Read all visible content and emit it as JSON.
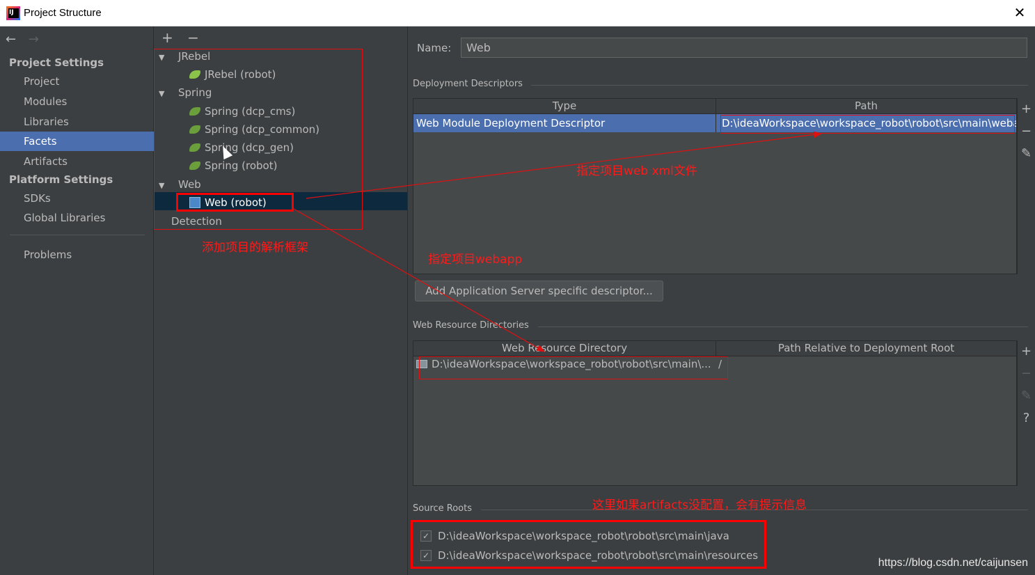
{
  "window": {
    "title": "Project Structure",
    "close_glyph": "✕"
  },
  "nav": {
    "back": "←",
    "forward": "→",
    "project_settings_header": "Project Settings",
    "platform_settings_header": "Platform Settings",
    "items": [
      "Project",
      "Modules",
      "Libraries",
      "Facets",
      "Artifacts"
    ],
    "platform_items": [
      "SDKs",
      "Global Libraries"
    ],
    "problems": "Problems",
    "selected": "Facets"
  },
  "tree": {
    "add": "+",
    "remove": "−",
    "nodes": [
      {
        "label": "JRebel",
        "type": "group"
      },
      {
        "label": "JRebel (robot)",
        "type": "jrebel"
      },
      {
        "label": "Spring",
        "type": "group"
      },
      {
        "label": "Spring (dcp_cms)",
        "type": "spring"
      },
      {
        "label": "Spring (dcp_common)",
        "type": "spring"
      },
      {
        "label": "Spring (dcp_gen)",
        "type": "spring"
      },
      {
        "label": "Spring (robot)",
        "type": "spring"
      },
      {
        "label": "Web",
        "type": "group"
      },
      {
        "label": "Web (robot)",
        "type": "web"
      },
      {
        "label": "Detection",
        "type": "plain"
      }
    ],
    "selected": "Web (robot)"
  },
  "facet": {
    "name_label": "Name:",
    "name_value": "Web",
    "deployment_descriptors": {
      "title": "Deployment Descriptors",
      "columns": [
        "Type",
        "Path"
      ],
      "rows": [
        {
          "type": "Web Module Deployment Descriptor",
          "path": "D:\\ideaWorkspace\\workspace_robot\\robot\\src\\main\\weba"
        }
      ]
    },
    "add_server_descriptor_button": "Add Application Server specific descriptor...",
    "web_resource_directories": {
      "title": "Web Resource Directories",
      "columns": [
        "Web Resource Directory",
        "Path Relative to Deployment Root"
      ],
      "rows": [
        {
          "directory": "D:\\ideaWorkspace\\workspace_robot\\robot\\src\\main\\...",
          "relative": "/"
        }
      ]
    },
    "source_roots": {
      "title": "Source Roots",
      "items": [
        {
          "path": "D:\\ideaWorkspace\\workspace_robot\\robot\\src\\main\\java",
          "checked": true
        },
        {
          "path": "D:\\ideaWorkspace\\workspace_robot\\robot\\src\\main\\resources",
          "checked": true
        }
      ]
    },
    "side_buttons": {
      "add": "+",
      "remove": "−",
      "edit": "✎",
      "help": "?"
    }
  },
  "annotations": {
    "add_framework": "添加项目的解析框架",
    "specify_webxml": "指定项目web xml文件",
    "specify_webapp": "指定项目webapp",
    "artifacts_hint": "这里如果artifacts没配置，会有提示信息",
    "color": "#ff1a1a"
  },
  "watermark": "https://blog.csdn.net/caijunsen"
}
